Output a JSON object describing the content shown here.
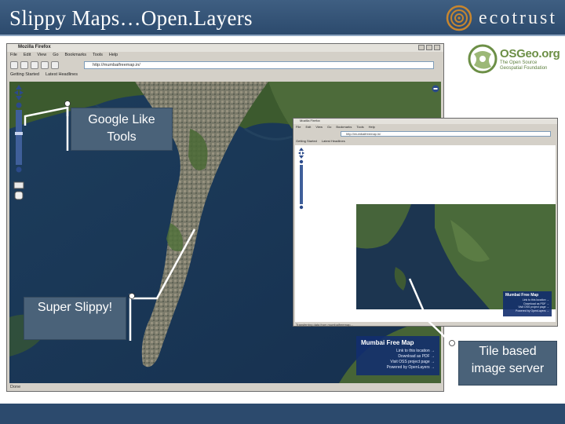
{
  "slide": {
    "title": "Slippy Maps…Open.Layers",
    "brand_name": "ecotrust"
  },
  "osgeo_logo": {
    "name": "OSGeo.org",
    "tagline_line1": "The Open Source",
    "tagline_line2": "Geospatial Foundation"
  },
  "browser_main": {
    "title": "Mozilla Firefox",
    "menu": [
      "File",
      "Edit",
      "View",
      "Go",
      "Bookmarks",
      "Tools",
      "Help"
    ],
    "url": "http://mumbaifreemap.in/",
    "bookmarks": [
      "Getting Started",
      "Latest Headlines"
    ],
    "status": "Done"
  },
  "browser_small": {
    "title": "Mozilla Firefox",
    "menu": [
      "File",
      "Edit",
      "View",
      "Go",
      "Bookmarks",
      "Tools",
      "Help"
    ],
    "url": "http://mumbaifreemap.in/",
    "bookmarks": [
      "Getting Started",
      "Latest Headlines"
    ],
    "status": "Transferring data from mumbaifreemap..."
  },
  "map_panel": {
    "title": "Mumbai Free Map",
    "links": [
      "Link to this location →",
      "Download as PDF →",
      "Visit OSS project page →",
      "Powered by OpenLayers →"
    ]
  },
  "map_panel_small": {
    "title": "Mumbai Free Map",
    "links": [
      "Link to this location →",
      "Download as PDF →",
      "Visit OSS project page →",
      "Powered by OpenLayers →"
    ]
  },
  "callouts": {
    "tools_line1": "Google Like",
    "tools_line2": "Tools",
    "slippy": "Super Slippy!",
    "tile_line1": "Tile based",
    "tile_line2": "image server"
  },
  "colors": {
    "header": "#2c4a6d",
    "callout": "#4a6279",
    "osgeo_green": "#6c8f46",
    "panel": "#122d6e"
  },
  "icons": [
    "ecotrust-logo-icon",
    "osgeo-logo-icon",
    "pan-arrows-icon",
    "zoom-slider-icon",
    "zoombox-icon",
    "pan-hand-icon",
    "layer-switcher-icon"
  ]
}
